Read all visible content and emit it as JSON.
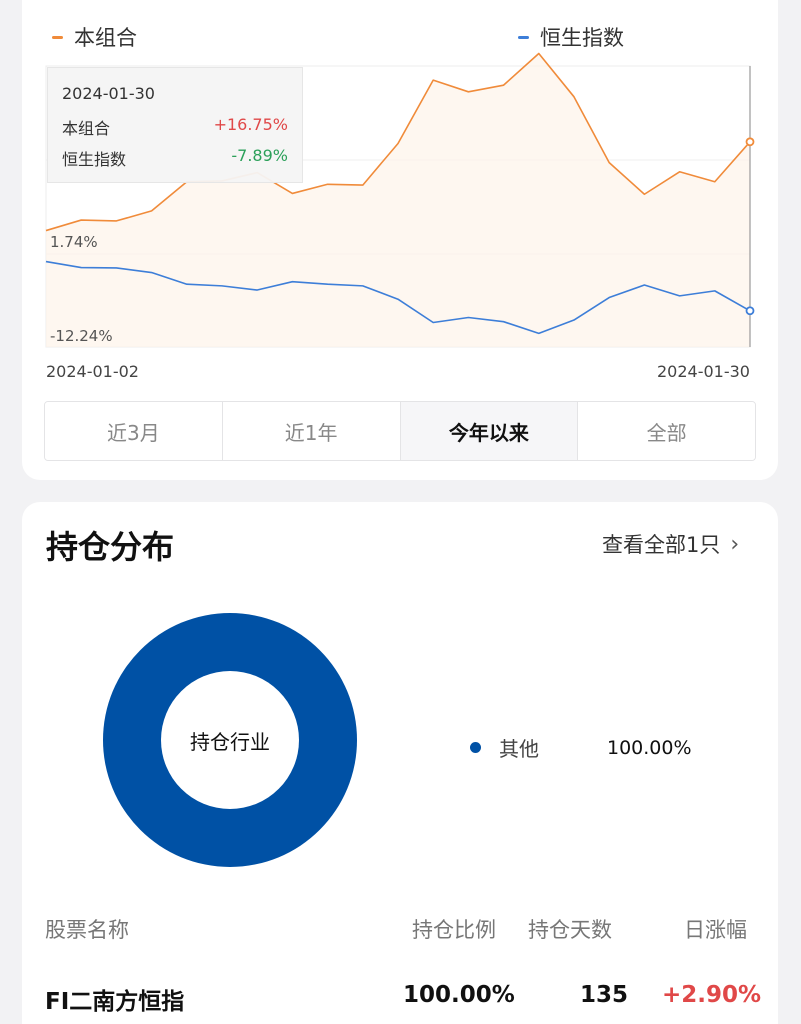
{
  "chart_legend": {
    "portfolio": {
      "label": "本组合",
      "color": "#f08b3a"
    },
    "index": {
      "label": "恒生指数",
      "color": "#3d7ed8"
    }
  },
  "tooltip": {
    "date": "2024-01-30",
    "rows": [
      {
        "name": "本组合",
        "value": "+16.75%",
        "color": "#e04848"
      },
      {
        "name": "恒生指数",
        "value": "-7.89%",
        "color": "#2ca05a"
      }
    ]
  },
  "chart_data": {
    "type": "line",
    "x_start_label": "2024-01-02",
    "x_end_label": "2024-01-30",
    "y_labels": [
      "1.74%",
      "-12.24%"
    ],
    "ylim": [
      -12.24,
      21.5
    ],
    "grid": true,
    "series": [
      {
        "name": "本组合",
        "color": "#f08b3a",
        "values": [
          1.74,
          3.0,
          2.9,
          4.1,
          7.6,
          7.7,
          8.7,
          6.2,
          7.3,
          7.2,
          12.2,
          19.8,
          18.4,
          19.2,
          23.0,
          17.8,
          9.9,
          6.1,
          8.8,
          7.6,
          12.4
        ]
      },
      {
        "name": "恒生指数",
        "color": "#3d7ed8",
        "values": [
          -1.98,
          -2.7,
          -2.75,
          -3.3,
          -4.7,
          -4.9,
          -5.4,
          -4.4,
          -4.7,
          -4.9,
          -6.5,
          -9.3,
          -8.7,
          -9.2,
          -10.6,
          -9.0,
          -6.3,
          -4.8,
          -6.1,
          -5.5,
          -7.89
        ]
      }
    ]
  },
  "range_tabs": [
    "近3月",
    "近1年",
    "今年以来",
    "全部"
  ],
  "active_range": "今年以来",
  "holdings": {
    "title": "持仓分布",
    "view_all": "查看全部1只",
    "donut_center": "持仓行业",
    "pie": [
      {
        "name": "其他",
        "value": 100.0,
        "pct_label": "100.00%",
        "color": "#0051a5"
      }
    ],
    "table": {
      "headers": [
        "股票名称",
        "持仓比例",
        "持仓天数",
        "日涨幅"
      ],
      "rows": [
        {
          "name": "FI二南方恒指",
          "ratio": "100.00%",
          "days": "135",
          "change": "+2.90%"
        }
      ]
    }
  }
}
